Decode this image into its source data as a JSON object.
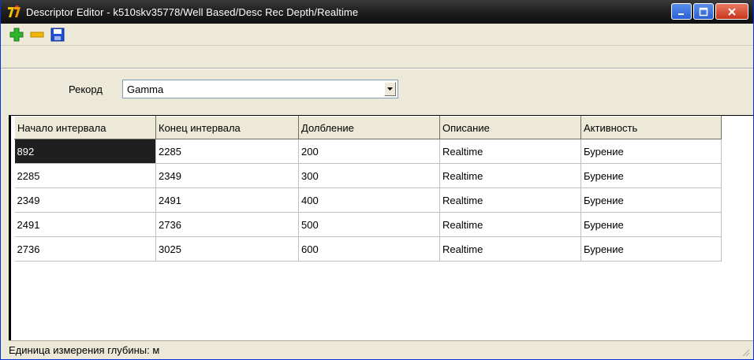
{
  "window": {
    "title": "Descriptor Editor - k510skv35778/Well Based/Desc Rec Depth/Realtime",
    "controls": [
      "minimize-icon",
      "maximize-icon",
      "close-icon"
    ]
  },
  "toolbar": {
    "buttons": [
      {
        "name": "add-icon",
        "color": "#2db52d"
      },
      {
        "name": "remove-icon",
        "color": "#f2b705"
      },
      {
        "name": "save-icon",
        "color": "#1d4fd8"
      }
    ]
  },
  "record": {
    "label": "Рекорд",
    "selected": "Gamma"
  },
  "grid": {
    "columns": [
      "Начало интервала",
      "Конец интервала",
      "Долбление",
      "Описание",
      "Активность"
    ],
    "rows": [
      [
        "892",
        "2285",
        "200",
        "Realtime",
        "Бурение"
      ],
      [
        "2285",
        "2349",
        "300",
        "Realtime",
        "Бурение"
      ],
      [
        "2349",
        "2491",
        "400",
        "Realtime",
        "Бурение"
      ],
      [
        "2491",
        "2736",
        "500",
        "Realtime",
        "Бурение"
      ],
      [
        "2736",
        "3025",
        "600",
        "Realtime",
        "Бурение"
      ]
    ],
    "selected_cell": [
      0,
      0
    ]
  },
  "status": {
    "text": "Единица измерения глубины: м"
  }
}
